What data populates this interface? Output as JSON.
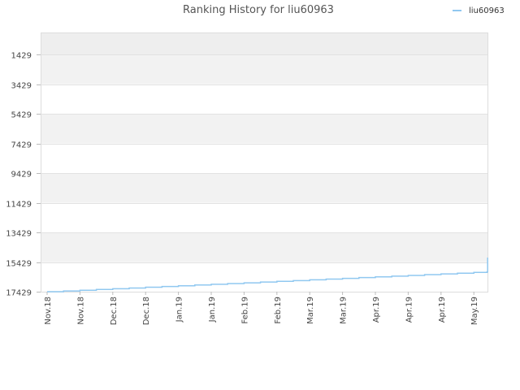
{
  "chart_data": {
    "type": "line",
    "title": "Ranking History for liu60963",
    "y_reversed": true,
    "ylim": [
      1429,
      17429
    ],
    "y_ticks": [
      1429,
      3429,
      5429,
      7429,
      9429,
      11429,
      13429,
      15429,
      17429
    ],
    "y_tick_labels": [
      "1429",
      "3429",
      "5429",
      "7429",
      "9429",
      "11429",
      "13429",
      "15429",
      "17429"
    ],
    "x_tick_labels": [
      "Nov.18",
      "Nov.18",
      "Dec.18",
      "Dec.18",
      "Jan.19",
      "Jan.19",
      "Feb.19",
      "Feb.19",
      "Mar.19",
      "Mar.19",
      "Apr.19",
      "Apr.19",
      "Apr.19",
      "May.19"
    ],
    "legend_position": "top-right",
    "grid": true,
    "series": [
      {
        "name": "liu60963",
        "color": "#90c8f0",
        "x_index": [
          0,
          0.2,
          0.5,
          1.0,
          1.5,
          2.0,
          2.5,
          3.0,
          3.5,
          4.0,
          4.5,
          5.0,
          5.5,
          6.0,
          6.5,
          7.0,
          7.5,
          8.0,
          8.5,
          9.0,
          9.5,
          10.0,
          10.5,
          11.0,
          11.5,
          12.0,
          12.5,
          13.0,
          13.4,
          13.42
        ],
        "values": [
          17429,
          17429,
          17380,
          17330,
          17280,
          17230,
          17180,
          17130,
          17080,
          17030,
          16980,
          16930,
          16880,
          16830,
          16780,
          16730,
          16680,
          16630,
          16580,
          16530,
          16480,
          16430,
          16380,
          16330,
          16280,
          16230,
          16180,
          16130,
          16100,
          15129
        ]
      }
    ]
  }
}
